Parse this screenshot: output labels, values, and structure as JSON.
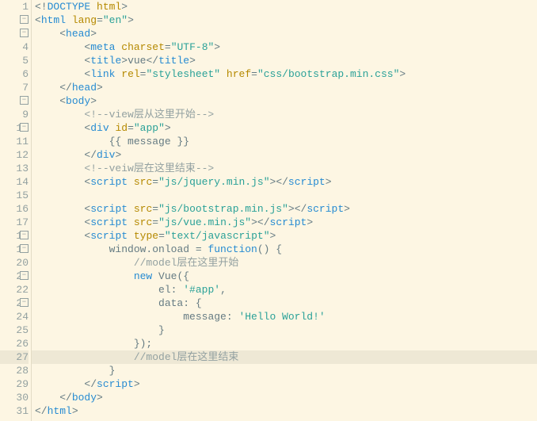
{
  "lines": [
    {
      "n": 1,
      "fold": false,
      "cls": "",
      "html": "<span class='pun'>&lt;!</span><span class='kw'>DOCTYPE</span> <span class='attr'>html</span><span class='pun'>&gt;</span>"
    },
    {
      "n": 2,
      "fold": true,
      "cls": "",
      "html": "<span class='pun'>&lt;</span><span class='kw'>html</span> <span class='attr'>lang</span><span class='pun'>=</span><span class='str'>\"en\"</span><span class='pun'>&gt;</span>"
    },
    {
      "n": 3,
      "fold": true,
      "cls": "",
      "html": "    <span class='pun'>&lt;</span><span class='kw'>head</span><span class='pun'>&gt;</span>"
    },
    {
      "n": 4,
      "fold": false,
      "cls": "",
      "html": "        <span class='pun'>&lt;</span><span class='kw'>meta</span> <span class='attr'>charset</span><span class='pun'>=</span><span class='str'>\"UTF-8\"</span><span class='pun'>&gt;</span>"
    },
    {
      "n": 5,
      "fold": false,
      "cls": "",
      "html": "        <span class='pun'>&lt;</span><span class='kw'>title</span><span class='pun'>&gt;</span><span class='def'>vue</span><span class='pun'>&lt;/</span><span class='kw'>title</span><span class='pun'>&gt;</span>"
    },
    {
      "n": 6,
      "fold": false,
      "cls": "",
      "html": "        <span class='pun'>&lt;</span><span class='kw'>link</span> <span class='attr'>rel</span><span class='pun'>=</span><span class='str'>\"stylesheet\"</span> <span class='attr'>href</span><span class='pun'>=</span><span class='str'>\"css/bootstrap.min.css\"</span><span class='pun'>&gt;</span>"
    },
    {
      "n": 7,
      "fold": false,
      "cls": "",
      "html": "    <span class='pun'>&lt;/</span><span class='kw'>head</span><span class='pun'>&gt;</span>"
    },
    {
      "n": 8,
      "fold": true,
      "cls": "",
      "html": "    <span class='pun'>&lt;</span><span class='kw'>body</span><span class='pun'>&gt;</span>"
    },
    {
      "n": 9,
      "fold": false,
      "cls": "",
      "html": "        <span class='cmt'>&lt;!--view层从这里开始--&gt;</span>"
    },
    {
      "n": 10,
      "fold": true,
      "cls": "",
      "html": "        <span class='pun'>&lt;</span><span class='kw'>div</span> <span class='attr'>id</span><span class='pun'>=</span><span class='str'>\"app\"</span><span class='pun'>&gt;</span>"
    },
    {
      "n": 11,
      "fold": false,
      "cls": "",
      "html": "            <span class='def'>{{ message }}</span>"
    },
    {
      "n": 12,
      "fold": false,
      "cls": "",
      "html": "        <span class='pun'>&lt;/</span><span class='kw'>div</span><span class='pun'>&gt;</span>"
    },
    {
      "n": 13,
      "fold": false,
      "cls": "",
      "html": "        <span class='cmt'>&lt;!--veiw层在这里结束--&gt;</span>"
    },
    {
      "n": 14,
      "fold": false,
      "cls": "",
      "html": "        <span class='pun'>&lt;</span><span class='kw'>script</span> <span class='attr'>src</span><span class='pun'>=</span><span class='str'>\"js/jquery.min.js\"</span><span class='pun'>&gt;&lt;/</span><span class='kw'>script</span><span class='pun'>&gt;</span>"
    },
    {
      "n": 15,
      "fold": false,
      "cls": "",
      "html": ""
    },
    {
      "n": 16,
      "fold": false,
      "cls": "",
      "html": "        <span class='pun'>&lt;</span><span class='kw'>script</span> <span class='attr'>src</span><span class='pun'>=</span><span class='str'>\"js/bootstrap.min.js\"</span><span class='pun'>&gt;&lt;/</span><span class='kw'>script</span><span class='pun'>&gt;</span>"
    },
    {
      "n": 17,
      "fold": false,
      "cls": "",
      "html": "        <span class='pun'>&lt;</span><span class='kw'>script</span> <span class='attr'>src</span><span class='pun'>=</span><span class='str'>\"js/vue.min.js\"</span><span class='pun'>&gt;&lt;/</span><span class='kw'>script</span><span class='pun'>&gt;</span>"
    },
    {
      "n": 18,
      "fold": true,
      "cls": "",
      "html": "        <span class='pun'>&lt;</span><span class='kw'>script</span> <span class='attr'>type</span><span class='pun'>=</span><span class='str'>\"text/javascript\"</span><span class='pun'>&gt;</span>"
    },
    {
      "n": 19,
      "fold": true,
      "cls": "",
      "html": "            <span class='def'>window.onload = </span><span class='kw'>function</span><span class='def'>() {</span>"
    },
    {
      "n": 20,
      "fold": false,
      "cls": "",
      "html": "                <span class='cmt'>//model层在这里开始</span>"
    },
    {
      "n": 21,
      "fold": true,
      "cls": "",
      "html": "                <span class='kw'>new</span> <span class='def'>Vue({</span>"
    },
    {
      "n": 22,
      "fold": false,
      "cls": "",
      "html": "                    <span class='def'>el: </span><span class='str'>'#app'</span><span class='def'>,</span>"
    },
    {
      "n": 23,
      "fold": true,
      "cls": "",
      "html": "                    <span class='def'>data: {</span>"
    },
    {
      "n": 24,
      "fold": false,
      "cls": "",
      "html": "                        <span class='def'>message: </span><span class='str'>'Hello World!'</span>"
    },
    {
      "n": 25,
      "fold": false,
      "cls": "",
      "html": "                    <span class='def'>}</span>"
    },
    {
      "n": 26,
      "fold": false,
      "cls": "",
      "html": "                <span class='def'>});</span>"
    },
    {
      "n": 27,
      "fold": false,
      "cls": "current",
      "html": "                <span class='cmt'>//model层在这里结束</span>"
    },
    {
      "n": 28,
      "fold": false,
      "cls": "",
      "html": "            <span class='def'>}</span>"
    },
    {
      "n": 29,
      "fold": false,
      "cls": "",
      "html": "        <span class='pun'>&lt;/</span><span class='kw'>script</span><span class='pun'>&gt;</span>"
    },
    {
      "n": 30,
      "fold": false,
      "cls": "",
      "html": "    <span class='pun'>&lt;/</span><span class='kw'>body</span><span class='pun'>&gt;</span>"
    },
    {
      "n": 31,
      "fold": false,
      "cls": "",
      "html": "<span class='pun'>&lt;/</span><span class='kw'>html</span><span class='pun'>&gt;</span>"
    }
  ],
  "fold_glyph": "−",
  "current_line": 27
}
